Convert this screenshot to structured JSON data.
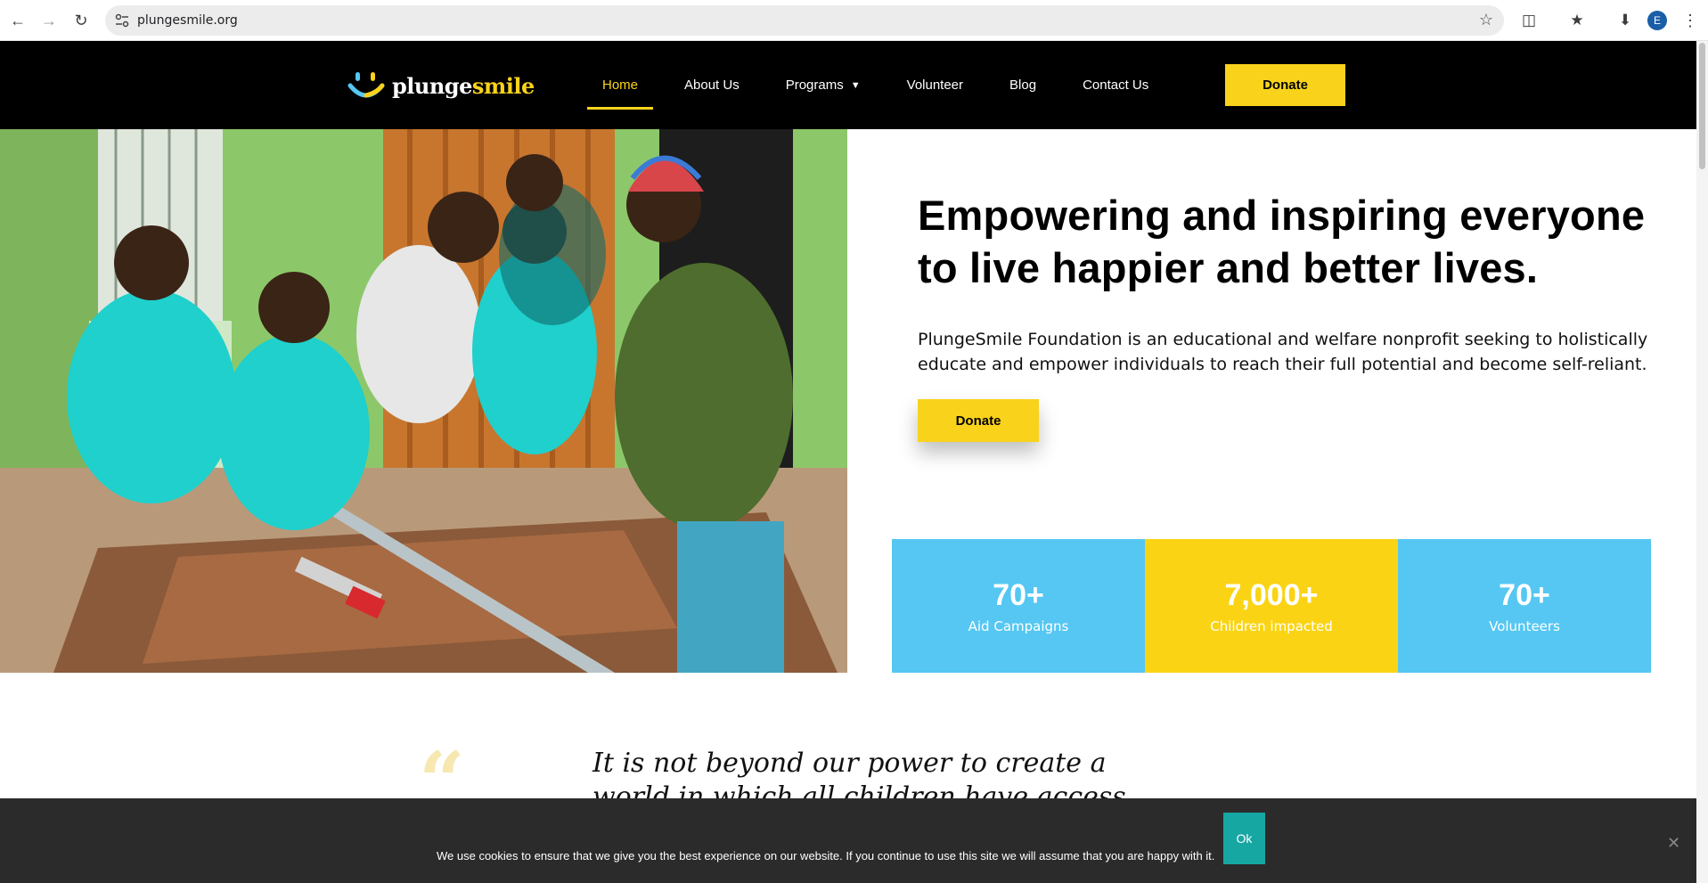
{
  "browser": {
    "url": "plungesmile.org",
    "profile_initial": "E",
    "icons": [
      "back-icon",
      "forward-icon",
      "reload-icon",
      "site-info-icon",
      "bookmark-star-icon",
      "extensions-icon",
      "bookmarks-icon",
      "download-icon",
      "menu-icon"
    ]
  },
  "header": {
    "logo_part1": "plunge",
    "logo_part2": "smile",
    "nav": [
      {
        "label": "Home",
        "active": true
      },
      {
        "label": "About Us"
      },
      {
        "label": "Programs",
        "has_dropdown": true
      },
      {
        "label": "Volunteer"
      },
      {
        "label": "Blog"
      },
      {
        "label": "Contact Us"
      }
    ],
    "donate_label": "Donate"
  },
  "hero": {
    "title": "Empowering and inspiring everyone to live happier and better lives.",
    "description": "PlungeSmile Foundation is an educational and welfare nonprofit seeking to holistically educate and empower individuals to reach their full potential and become self-reliant.",
    "donate_label": "Donate"
  },
  "stats": [
    {
      "value": "70+",
      "label": "Aid Campaigns",
      "color": "#55c7f2"
    },
    {
      "value": "7,000+",
      "label": "Children impacted",
      "color": "#fad414"
    },
    {
      "value": "70+",
      "label": "Volunteers",
      "color": "#55c7f2"
    }
  ],
  "quote": {
    "text": "It is not beyond our power to create a world in which all children have access to a good education."
  },
  "cookie": {
    "message": "We use cookies to ensure that we give you the best experience on our website. If you continue to use this site we will assume that you are happy with it.",
    "ok_label": "Ok"
  },
  "colors": {
    "brand_yellow": "#f9d31b",
    "brand_blue": "#55c7f2",
    "cookie_ok": "#16a7a3"
  }
}
